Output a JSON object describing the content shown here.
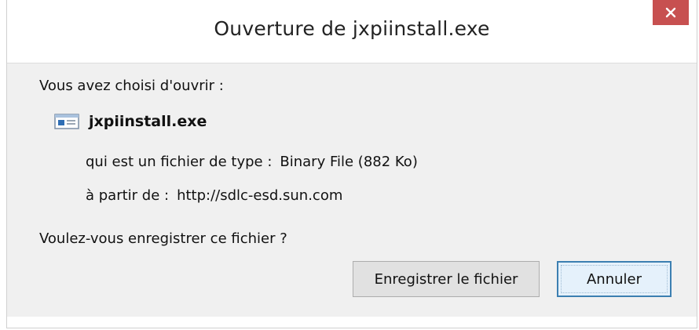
{
  "window": {
    "title": "Ouverture de jxpiinstall.exe",
    "close_symbol": "×"
  },
  "dialog": {
    "opening_prompt": "Vous avez choisi d'ouvrir :",
    "file": {
      "icon": "application-file-icon",
      "name": "jxpiinstall.exe"
    },
    "type_label": "qui est un fichier de type :",
    "type_value": "Binary File (882 Ko)",
    "from_label": "à partir de :",
    "from_value": "http://sdlc-esd.sun.com",
    "question": "Voulez-vous enregistrer ce fichier ?"
  },
  "buttons": {
    "save_label": "Enregistrer le fichier",
    "cancel_label": "Annuler"
  },
  "colors": {
    "close_bg": "#c75050",
    "content_bg": "#f0f0f0",
    "default_button_border": "#3c7fb1"
  }
}
